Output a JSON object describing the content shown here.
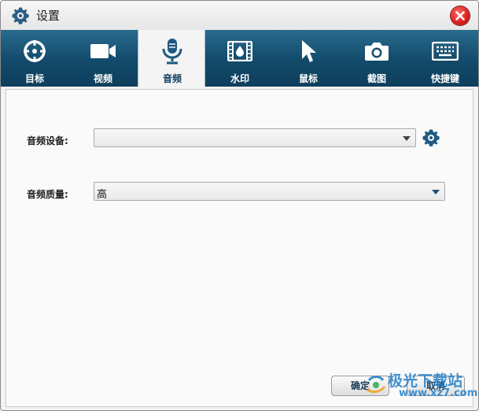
{
  "window": {
    "title": "设置"
  },
  "tabs": [
    {
      "label": "目标",
      "icon": "target-icon",
      "active": false
    },
    {
      "label": "视频",
      "icon": "video-camera-icon",
      "active": false
    },
    {
      "label": "音频",
      "icon": "microphone-icon",
      "active": true
    },
    {
      "label": "水印",
      "icon": "film-watermark-icon",
      "active": false
    },
    {
      "label": "鼠标",
      "icon": "mouse-cursor-icon",
      "active": false
    },
    {
      "label": "截图",
      "icon": "camera-icon",
      "active": false
    },
    {
      "label": "快捷键",
      "icon": "keyboard-icon",
      "active": false
    }
  ],
  "audio": {
    "device_label": "音频设备:",
    "device_value": "",
    "quality_label": "音频质量:",
    "quality_value": "高"
  },
  "buttons": {
    "ok": "确定",
    "cancel": "取消"
  },
  "watermark": {
    "text": "极光下载站",
    "url": "www.xz7.com"
  },
  "colors": {
    "accent": "#124a6a",
    "close": "#d91f1f",
    "icon_blue": "#1d5a82"
  }
}
